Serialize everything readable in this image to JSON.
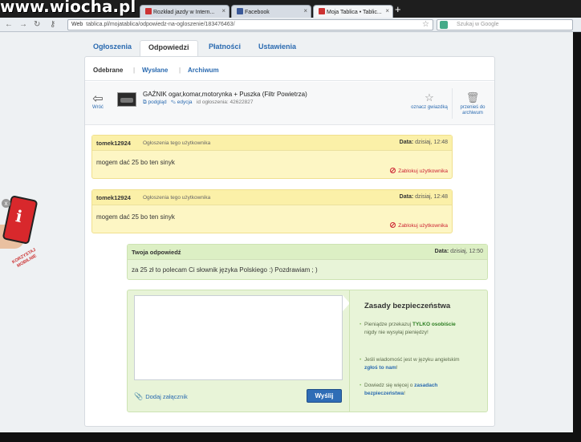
{
  "watermark": "www.wiocha.pl",
  "browser": {
    "tabs": [
      {
        "label": "Rozkład jazdy w Intern...",
        "favicon_color": "#c33"
      },
      {
        "label": "Facebook",
        "favicon_color": "#3b5998"
      },
      {
        "label": "Moja Tablica • Tablic...",
        "favicon_color": "#c33"
      }
    ],
    "new_tab": "+",
    "url_prefix": "Web",
    "url": "tablica.pl/mojatablica/odpowiedz-na-ogloszenie/183476463/",
    "search_placeholder": "Szukaj w Google"
  },
  "site_tabs": [
    "Ogłoszenia",
    "Odpowiedzi",
    "Płatności",
    "Ustawienia"
  ],
  "sub_tabs": {
    "received": "Odebrane",
    "sent": "Wysłane",
    "archive": "Archiwum",
    "sep": "|"
  },
  "ad": {
    "back": "Wróć",
    "title": "GAŹNIK ogar,komar,motorynka + Puszka (Filtr Powietrza)",
    "preview": "podgląd",
    "edit": "edycja",
    "id_label": "id ogłoszenia:",
    "id": "42622827",
    "star_label": "oznacz gwiazdką",
    "archive_label": "przenieś do archiwum"
  },
  "messages": [
    {
      "author": "tomek12924",
      "user_ads": "Ogłoszenia tego użytkownika",
      "date_label": "Data:",
      "date": "dzisiaj, 12:48",
      "text": "mogem dać 25 bo ten sinyk",
      "block": "Zablokuj użytkownika"
    },
    {
      "author": "tomek12924",
      "user_ads": "Ogłoszenia tego użytkownika",
      "date_label": "Data:",
      "date": "dzisiaj, 12:48",
      "text": "mogem dać 25 bo ten sinyk",
      "block": "Zablokuj użytkownika"
    },
    {
      "author": "Twoja odpowiedź",
      "date_label": "Data:",
      "date": "dzisiaj, 12:50",
      "text": "za 25 zł to polecam Ci słownik języka Polskiego :) Pozdrawiam ; )"
    }
  ],
  "reply": {
    "attach": "Dodaj załącznik",
    "send": "Wyślij"
  },
  "rules": {
    "title": "Zasady bezpieczeństwa",
    "r1_a": "Pieniądze przekazuj ",
    "r1_b": "TYLKO osobiście",
    "r1_c": " nigdy nie wysyłaj pieniędzy!",
    "r2_a": "Jeśli wiadomość jest w języku angielskim ",
    "r2_b": "zgłoś to nam",
    "r2_c": "!",
    "r3_a": "Dowiedz się więcej o ",
    "r3_b": "zasadach bezpieczeństwa",
    "r3_c": "!"
  },
  "promo": {
    "text": "KORZYSTAJ MOBILNIE",
    "close": "x"
  }
}
